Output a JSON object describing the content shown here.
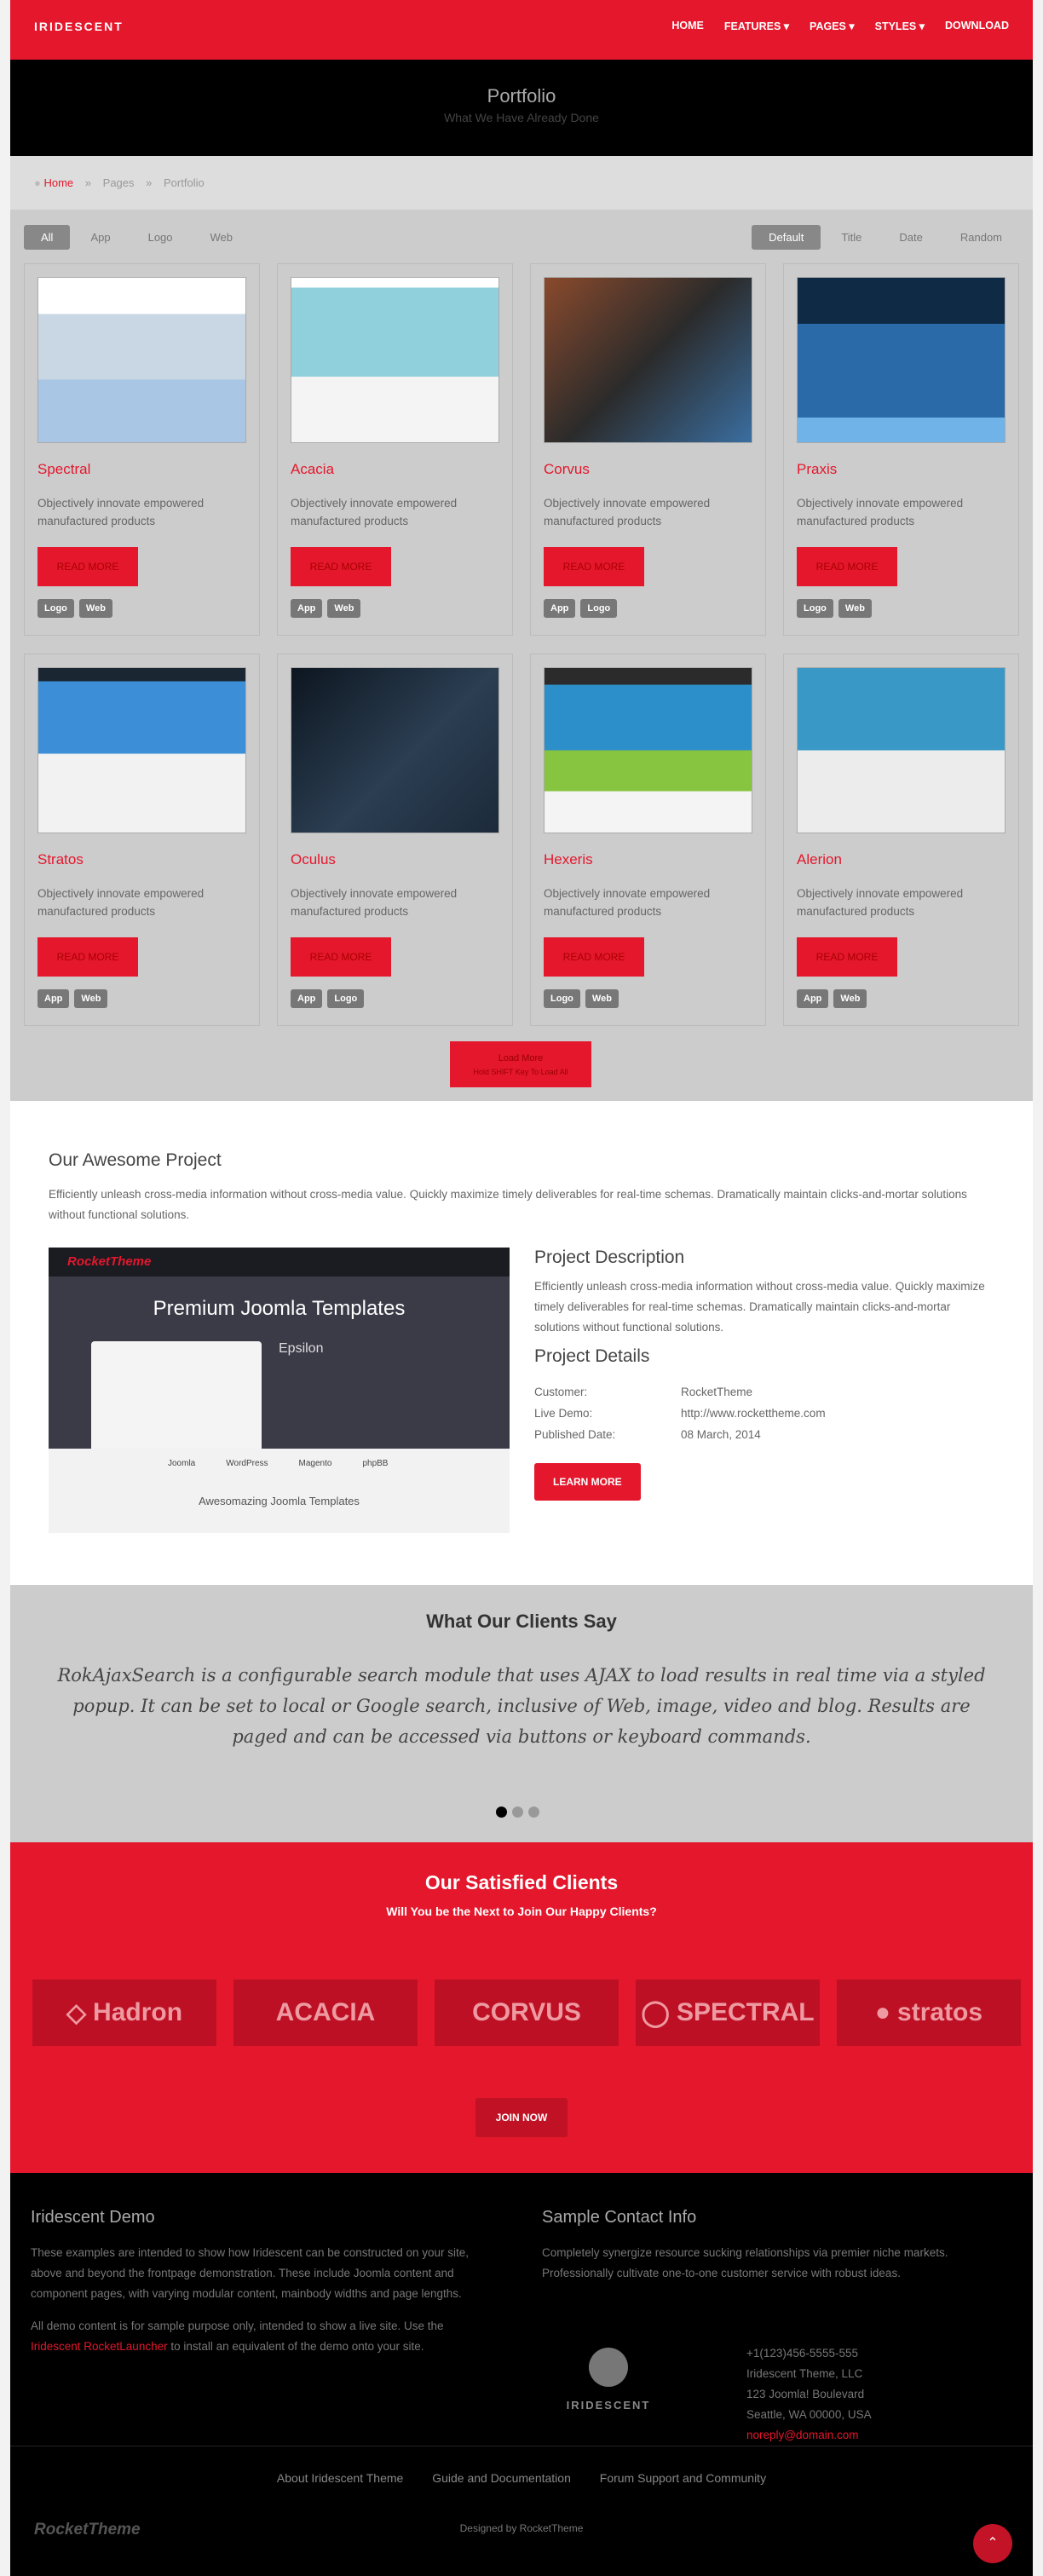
{
  "header": {
    "logo": "IRIDESCENT",
    "nav": [
      "HOME",
      "FEATURES ▾",
      "PAGES ▾",
      "STYLES ▾",
      "DOWNLOAD"
    ]
  },
  "hero": {
    "title": "Portfolio",
    "subtitle": "What We Have Already Done"
  },
  "breadcrumb": {
    "home": "Home",
    "pages": "Pages",
    "current": "Portfolio"
  },
  "portfolio": {
    "filters": [
      "All",
      "App",
      "Logo",
      "Web"
    ],
    "sorts": [
      "Default",
      "Title",
      "Date",
      "Random"
    ],
    "read_more": "READ MORE",
    "description": "Objectively innovate empowered manufactured products",
    "items": [
      {
        "title": "Spectral",
        "tags": [
          "Logo",
          "Web"
        ],
        "color": "#a9c6e4"
      },
      {
        "title": "Acacia",
        "tags": [
          "App",
          "Web"
        ],
        "color": "#8fd0dc"
      },
      {
        "title": "Corvus",
        "tags": [
          "App",
          "Logo"
        ],
        "color": "#8a4a2c"
      },
      {
        "title": "Praxis",
        "tags": [
          "Logo",
          "Web"
        ],
        "color": "#2a6aa8"
      },
      {
        "title": "Stratos",
        "tags": [
          "App",
          "Web"
        ],
        "color": "#3c8fd6"
      },
      {
        "title": "Oculus",
        "tags": [
          "App",
          "Logo"
        ],
        "color": "#1c2a3a"
      },
      {
        "title": "Hexeris",
        "tags": [
          "Logo",
          "Web"
        ],
        "color": "#2d8fc9"
      },
      {
        "title": "Alerion",
        "tags": [
          "App",
          "Web"
        ],
        "color": "#3a98c7"
      }
    ],
    "load_more": "Load More",
    "load_more_sub": "Hold SHIFT Key To Load All"
  },
  "project": {
    "title": "Our Awesome Project",
    "intro": "Efficiently unleash cross-media information without cross-media value. Quickly maximize timely deliverables for real-time schemas. Dramatically maintain clicks-and-mortar solutions without functional solutions.",
    "screenshot": {
      "brand": "RocketTheme",
      "heading": "Premium Joomla Templates",
      "template": "Epsilon",
      "caption": "Awesomazing Joomla Templates",
      "platforms": [
        "Joomla",
        "WordPress",
        "Magento",
        "phpBB"
      ]
    },
    "desc_title": "Project Description",
    "desc": "Efficiently unleash cross-media information without cross-media value. Quickly maximize timely deliverables for real-time schemas. Dramatically maintain clicks-and-mortar solutions without functional solutions.",
    "details_title": "Project Details",
    "customer_label": "Customer:",
    "customer": "RocketTheme",
    "demo_label": "Live Demo:",
    "demo": "http://www.rockettheme.com",
    "published_label": "Published Date:",
    "published": "08 March, 2014",
    "learn_more": "LEARN MORE"
  },
  "clients": {
    "title": "What Our Clients Say",
    "quote": "RokAjaxSearch is a configurable search module that uses AJAX to load results in real time via a styled popup. It can be set to local or Google search, inclusive of Web, image, video and blog. Results are paged and can be accessed via buttons or keyboard commands.",
    "slides": 3,
    "active_slide": 1
  },
  "satisfied": {
    "title": "Our Satisfied Clients",
    "subtitle": "Will You be the Next to Join Our Happy Clients?",
    "logos": [
      "Hadron",
      "ACACIA",
      "CORVUS",
      "SPECTRAL",
      "stratos"
    ],
    "join": "JOIN NOW"
  },
  "footer": {
    "demo_title": "Iridescent Demo",
    "demo_p1": "These examples are intended to show how Iridescent can be constructed on your site, above and beyond the frontpage demonstration. These include Joomla content and component pages, with varying modular content, mainbody widths and page lengths.",
    "demo_p2a": "All demo content is for sample purpose only, intended to show a live site. Use the",
    "demo_link": "Iridescent RocketLauncher",
    "demo_p2b": "to install an equivalent of the demo onto your site.",
    "contact_title": "Sample Contact Info",
    "contact_p": "Completely synergize resource sucking relationships via premier niche markets. Professionally cultivate one-to-one customer service with robust ideas.",
    "logo_text": "IRIDESCENT",
    "phone": "+1(123)456-5555-555",
    "company": "Iridescent Theme, LLC",
    "street": "123 Joomla! Boulevard",
    "city": "Seattle, WA 00000, USA",
    "email": "noreply@domain.com",
    "links": [
      "About Iridescent Theme",
      "Guide and Documentation",
      "Forum Support and Community"
    ],
    "designed": "Designed by RocketTheme",
    "brand": "RocketTheme"
  }
}
